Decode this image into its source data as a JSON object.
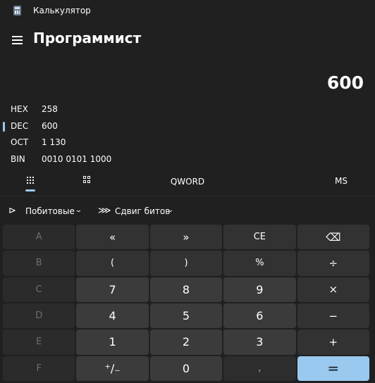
{
  "window": {
    "title": "Калькулятор",
    "icon": "calculator-icon"
  },
  "header": {
    "mode_title": "Программист",
    "menu_icon": "hamburger-menu-icon"
  },
  "display": {
    "value": "600"
  },
  "radix": [
    {
      "name": "HEX",
      "value": "258",
      "selected": false
    },
    {
      "name": "DEC",
      "value": "600",
      "selected": true
    },
    {
      "name": "OCT",
      "value": "1 130",
      "selected": false
    },
    {
      "name": "BIN",
      "value": "0010 0101 1000",
      "selected": false
    }
  ],
  "tabs": {
    "keypad_icon": "full-keypad-icon",
    "bits_icon": "bit-toggle-keypad-icon",
    "word_size": "QWORD",
    "memory": "MS"
  },
  "dropdowns": {
    "bitwise": {
      "label": "Побитовые",
      "icon": "bitwise-gate-icon",
      "glyph": "⊳",
      "chevron": "⌄"
    },
    "bitshift": {
      "label": "Сдвиг битов",
      "icon": "bit-shift-icon",
      "glyph": "⋙",
      "chevron": "⌄"
    }
  },
  "keys": [
    {
      "name": "key-a",
      "label": "A",
      "style": "dis"
    },
    {
      "name": "key-left-shift",
      "label": "«",
      "style": "op"
    },
    {
      "name": "key-right-shift",
      "label": "»",
      "style": "op"
    },
    {
      "name": "key-clear-entry",
      "label": "CE",
      "style": "op small"
    },
    {
      "name": "key-backspace",
      "label": "⌫",
      "style": "op"
    },
    {
      "name": "key-b",
      "label": "B",
      "style": "dis"
    },
    {
      "name": "key-open-paren",
      "label": "(",
      "style": "op small"
    },
    {
      "name": "key-close-paren",
      "label": ")",
      "style": "op small"
    },
    {
      "name": "key-modulo",
      "label": "%",
      "style": "op small"
    },
    {
      "name": "key-divide",
      "label": "÷",
      "style": "op"
    },
    {
      "name": "key-c",
      "label": "C",
      "style": "dis"
    },
    {
      "name": "key-7",
      "label": "7",
      "style": "num"
    },
    {
      "name": "key-8",
      "label": "8",
      "style": "num"
    },
    {
      "name": "key-9",
      "label": "9",
      "style": "num"
    },
    {
      "name": "key-multiply",
      "label": "×",
      "style": "op"
    },
    {
      "name": "key-d",
      "label": "D",
      "style": "dis"
    },
    {
      "name": "key-4",
      "label": "4",
      "style": "num"
    },
    {
      "name": "key-5",
      "label": "5",
      "style": "num"
    },
    {
      "name": "key-6",
      "label": "6",
      "style": "num"
    },
    {
      "name": "key-minus",
      "label": "−",
      "style": "op"
    },
    {
      "name": "key-e",
      "label": "E",
      "style": "dis"
    },
    {
      "name": "key-1",
      "label": "1",
      "style": "num"
    },
    {
      "name": "key-2",
      "label": "2",
      "style": "num"
    },
    {
      "name": "key-3",
      "label": "3",
      "style": "num"
    },
    {
      "name": "key-plus",
      "label": "+",
      "style": "op"
    },
    {
      "name": "key-f",
      "label": "F",
      "style": "dis"
    },
    {
      "name": "key-negate",
      "label": "⁺∕₋",
      "style": "num"
    },
    {
      "name": "key-0",
      "label": "0",
      "style": "num"
    },
    {
      "name": "key-decimal",
      "label": ",",
      "style": "empty"
    },
    {
      "name": "key-equals",
      "label": "=",
      "style": "eq"
    }
  ],
  "colors": {
    "accent": "#99c9ef",
    "background": "#202020"
  }
}
